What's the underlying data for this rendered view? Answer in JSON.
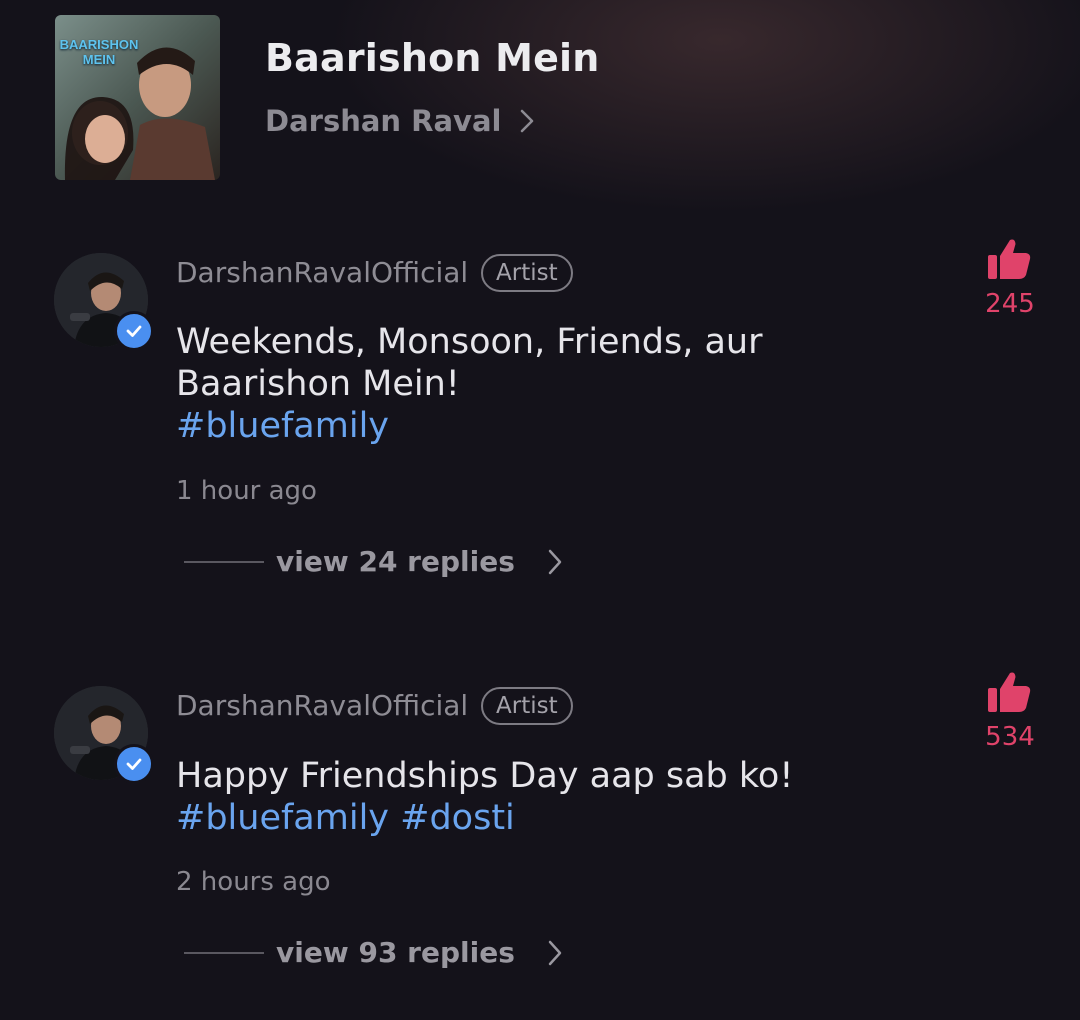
{
  "song": {
    "cover_title": "BAARISHON MEIN",
    "title": "Baarishon Mein",
    "artist": "Darshan Raval"
  },
  "comments": [
    {
      "username": "DarshanRavalOfficial",
      "badge": "Artist",
      "text": "Weekends, Monsoon, Friends, aur Baarishon Mein!",
      "hashtags": "#bluefamily",
      "time": "1 hour ago",
      "likes": "245",
      "replies": "view 24 replies",
      "verified": true
    },
    {
      "username": "DarshanRavalOfficial",
      "badge": "Artist",
      "text": "Happy Friendships Day aap sab ko!",
      "hashtags": "#bluefamily #dosti",
      "time": "2 hours ago",
      "likes": "534",
      "replies": "view 93 replies",
      "verified": true
    }
  ],
  "colors": {
    "background": "#14121a",
    "accent_like": "#e0436a",
    "hashtag": "#6aa4ee",
    "verified": "#4a8ff0"
  },
  "icons": [
    "chevron-right-icon",
    "thumbs-up-icon",
    "verified-check-icon"
  ]
}
